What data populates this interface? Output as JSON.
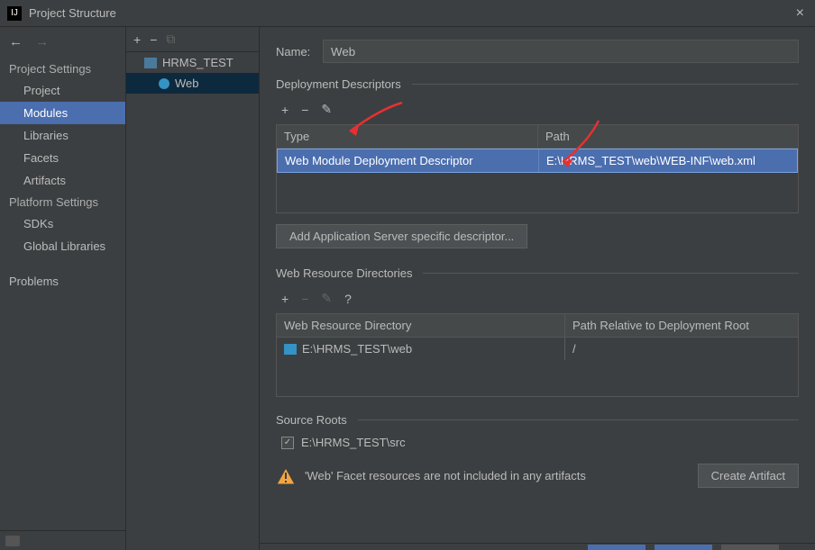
{
  "window": {
    "title": "Project Structure"
  },
  "nav": {
    "section1": "Project Settings",
    "items1": [
      "Project",
      "Modules",
      "Libraries",
      "Facets",
      "Artifacts"
    ],
    "selected1": "Modules",
    "section2": "Platform Settings",
    "items2": [
      "SDKs",
      "Global Libraries"
    ],
    "problems": "Problems"
  },
  "tree": {
    "root": "HRMS_TEST",
    "child": "Web"
  },
  "main": {
    "name_label": "Name:",
    "name_value": "Web",
    "dd_section": "Deployment Descriptors",
    "dd_headers": {
      "type": "Type",
      "path": "Path"
    },
    "dd_row": {
      "type": "Web Module Deployment Descriptor",
      "path": "E:\\HRMS_TEST\\web\\WEB-INF\\web.xml"
    },
    "dd_button": "Add Application Server specific descriptor...",
    "wrd_section": "Web Resource Directories",
    "wrd_headers": {
      "dir": "Web Resource Directory",
      "rel": "Path Relative to Deployment Root"
    },
    "wrd_row": {
      "dir": "E:\\HRMS_TEST\\web",
      "rel": "/"
    },
    "sr_section": "Source Roots",
    "sr_item": "E:\\HRMS_TEST\\src",
    "warning": "'Web' Facet resources are not included in any artifacts",
    "create_artifact": "Create Artifact"
  }
}
